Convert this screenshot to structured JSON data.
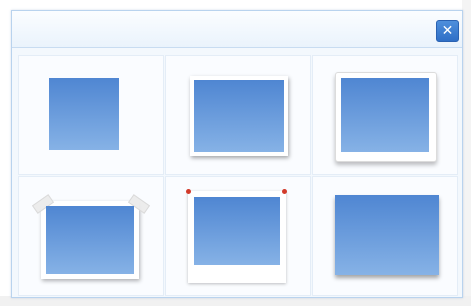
{
  "dialog": {
    "close_icon": "close-icon",
    "close_glyph": "✕",
    "accent_color": "#3a7bd5"
  },
  "styles": [
    {
      "name": "plain-photo"
    },
    {
      "name": "white-border-shadow"
    },
    {
      "name": "curled-border"
    },
    {
      "name": "taped-corners"
    },
    {
      "name": "pinned-polaroid"
    },
    {
      "name": "drop-shadow"
    }
  ]
}
